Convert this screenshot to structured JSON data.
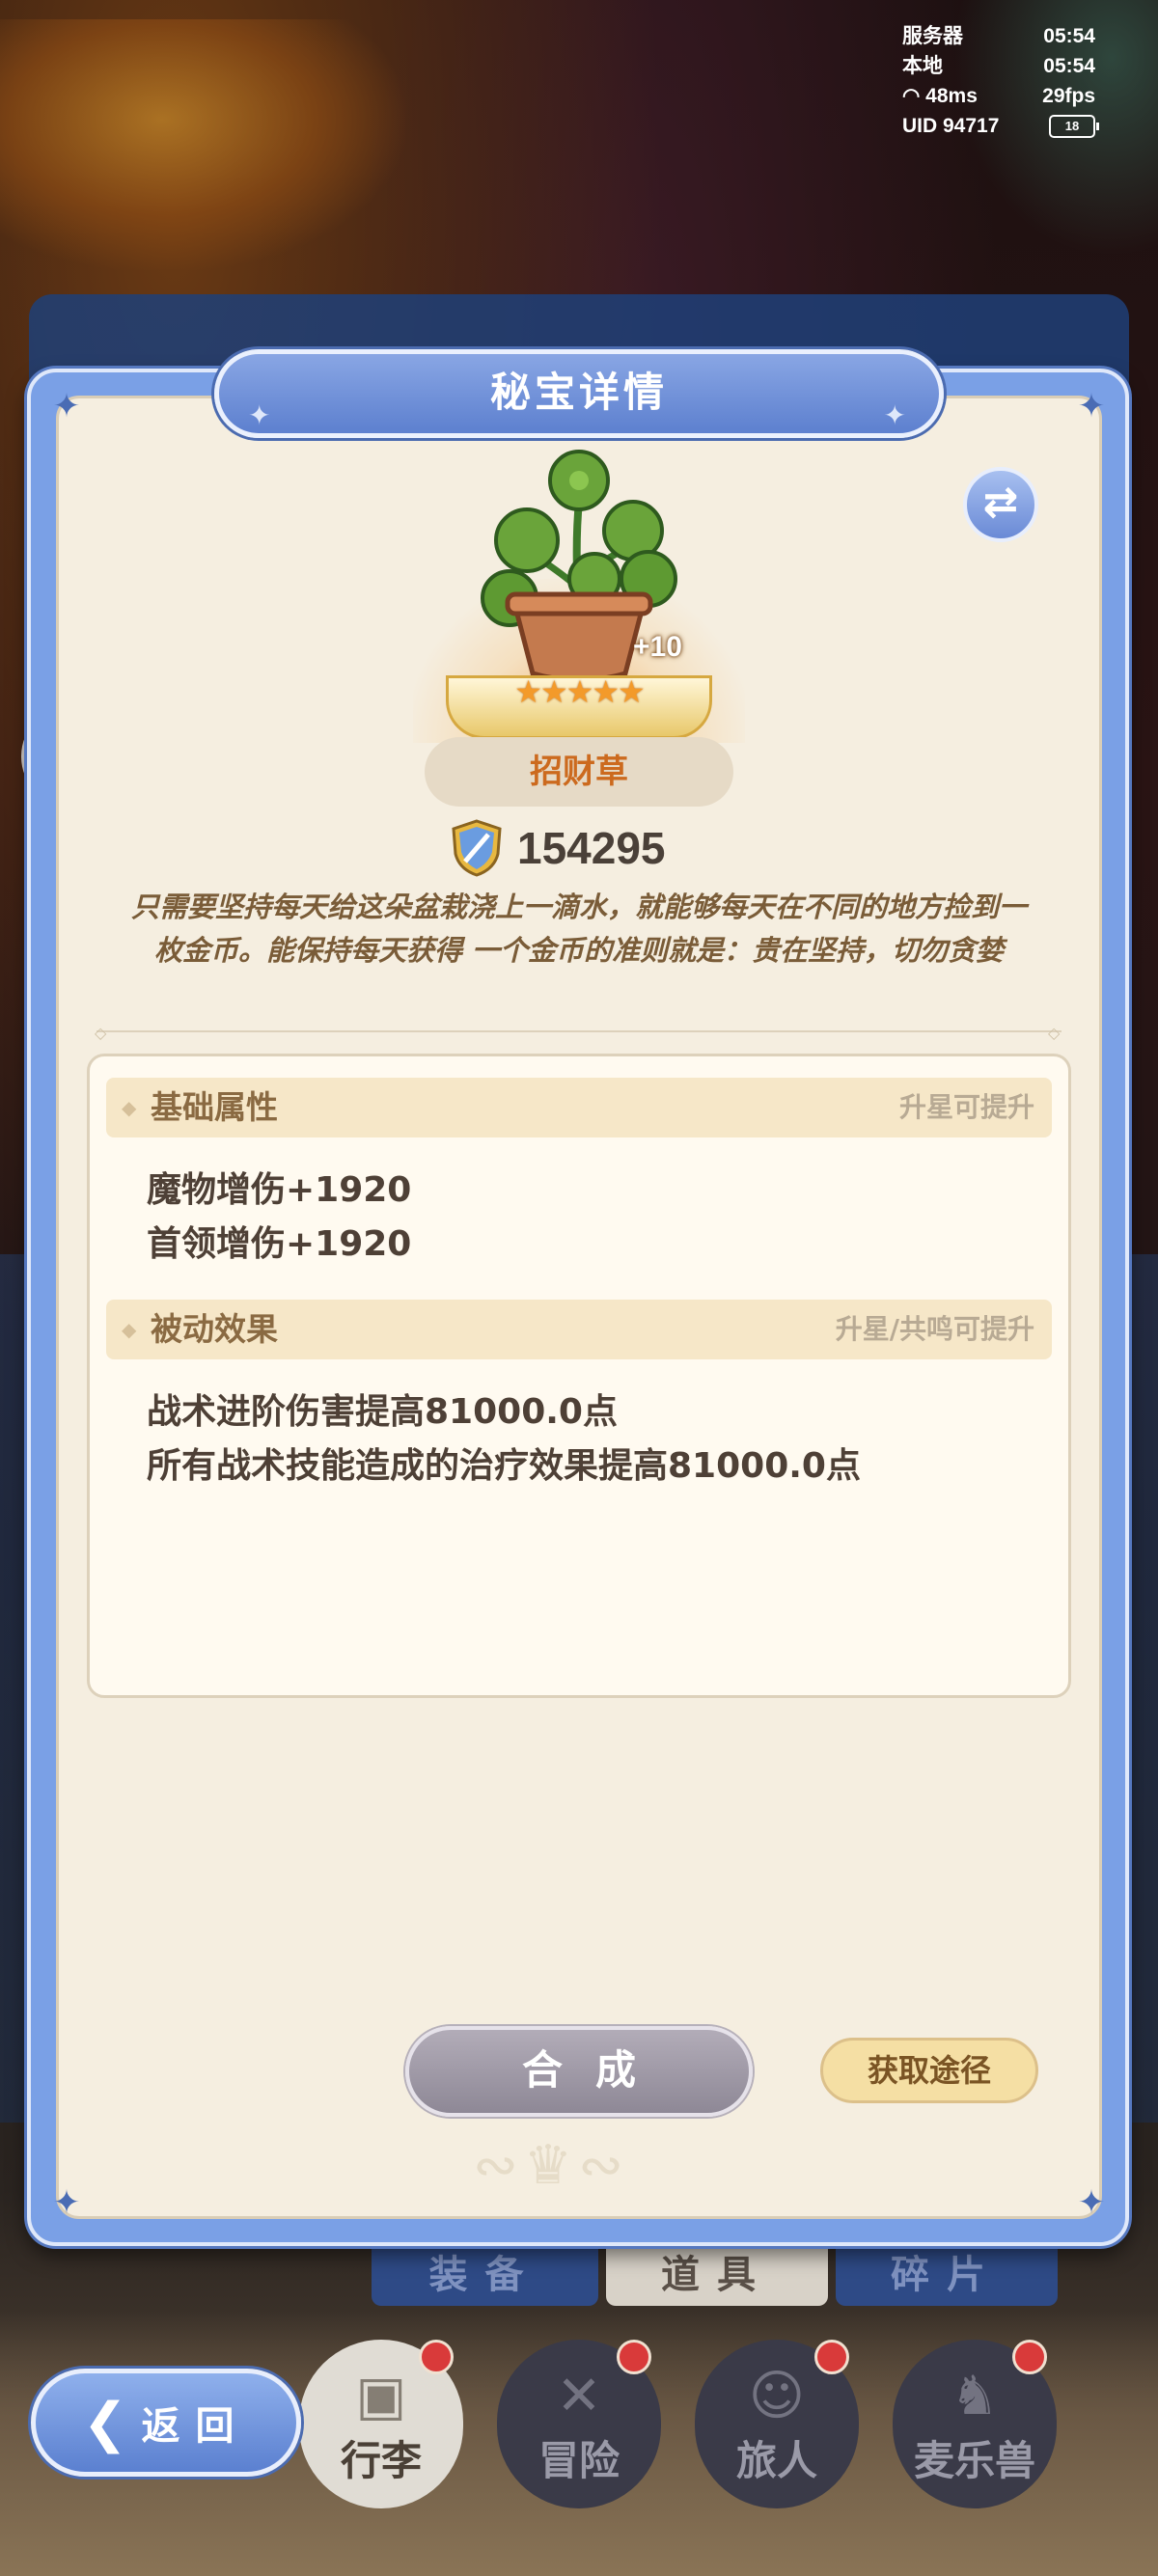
{
  "status": {
    "server_label": "服务器",
    "server_time": "05:54",
    "local_label": "本地",
    "local_time": "05:54",
    "ping": "48ms",
    "fps": "29fps",
    "uid": "UID 94717",
    "battery": "18"
  },
  "modal": {
    "title": "秘宝详情",
    "item_name": "招财草",
    "enhance_level": "+10",
    "stars": "★★★★★",
    "power": "154295",
    "description": "只需要坚持每天给这朵盆栽浇上一滴水，就能够每天在不同的地方捡到一枚金币。能保持每天获得 一个金币的准则就是：贵在坚持，切勿贪婪",
    "base_attr": {
      "title": "基础属性",
      "hint": "升星可提升",
      "stats": [
        "魔物增伤+1920",
        "首领增伤+1920"
      ]
    },
    "passive": {
      "title": "被动效果",
      "hint": "升星/共鸣可提升",
      "stats": [
        "战术进阶伤害提高81000.0点",
        "所有战术技能造成的治疗效果提高81000.0点"
      ]
    },
    "combine_label": "合成",
    "obtain_label": "获取途径"
  },
  "subtabs": [
    "装备",
    "道具",
    "碎片"
  ],
  "nav": {
    "back_label": "返回",
    "items": [
      "行李",
      "冒险",
      "旅人",
      "麦乐兽"
    ]
  },
  "colors": {
    "modal_frame": "#7aa0e6",
    "parchment": "#f5eee0",
    "item_name": "#cc6a1e",
    "section_header": "#f6e7c8"
  }
}
